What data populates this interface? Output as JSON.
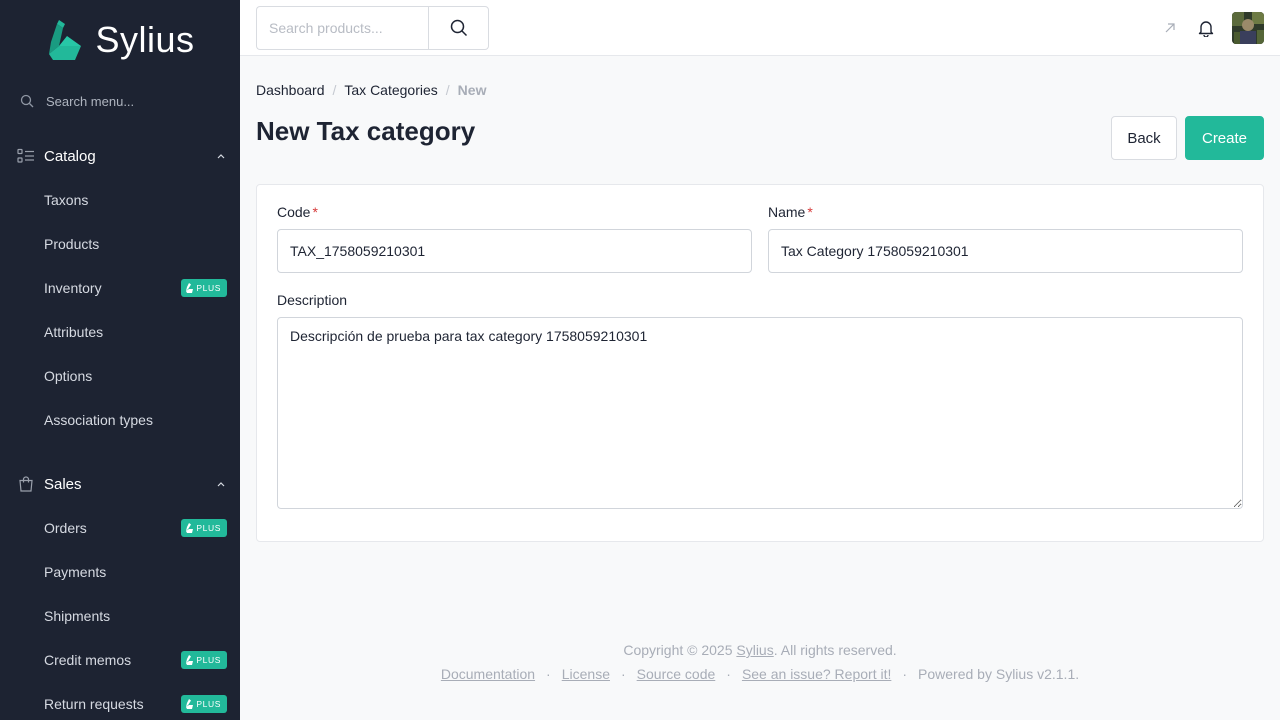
{
  "brand": {
    "name": "Sylius",
    "accent": "#22b99a",
    "sidebar_bg": "#1d2332"
  },
  "sidebar": {
    "search_placeholder": "Search menu...",
    "sections": [
      {
        "label": "Catalog",
        "icon": "catalog-icon",
        "expanded": true,
        "items": [
          {
            "label": "Taxons",
            "plus": false
          },
          {
            "label": "Products",
            "plus": false
          },
          {
            "label": "Inventory",
            "plus": true
          },
          {
            "label": "Attributes",
            "plus": false
          },
          {
            "label": "Options",
            "plus": false
          },
          {
            "label": "Association types",
            "plus": false
          }
        ]
      },
      {
        "label": "Sales",
        "icon": "shopping-bag-icon",
        "expanded": true,
        "items": [
          {
            "label": "Orders",
            "plus": true
          },
          {
            "label": "Payments",
            "plus": false
          },
          {
            "label": "Shipments",
            "plus": false
          },
          {
            "label": "Credit memos",
            "plus": true
          },
          {
            "label": "Return requests",
            "plus": true
          }
        ]
      }
    ],
    "plus_badge": "PLUS"
  },
  "topbar": {
    "search_placeholder": "Search products..."
  },
  "breadcrumb": {
    "items": [
      "Dashboard",
      "Tax Categories"
    ],
    "current": "New"
  },
  "page": {
    "title": "New Tax category",
    "back_label": "Back",
    "create_label": "Create"
  },
  "form": {
    "code_label": "Code",
    "code_value": "TAX_1758059210301",
    "name_label": "Name",
    "name_value": "Tax Category 1758059210301",
    "required_mark": "*",
    "description_label": "Description",
    "description_value": "Descripción de prueba para tax category 1758059210301"
  },
  "footer": {
    "copyright_prefix": "Copyright © 2025 ",
    "copyright_link": "Sylius",
    "copyright_suffix": ". All rights reserved.",
    "links": [
      "Documentation",
      "License",
      "Source code",
      "See an issue? Report it!"
    ],
    "separator": "·",
    "powered": "Powered by Sylius v2.1.1."
  }
}
